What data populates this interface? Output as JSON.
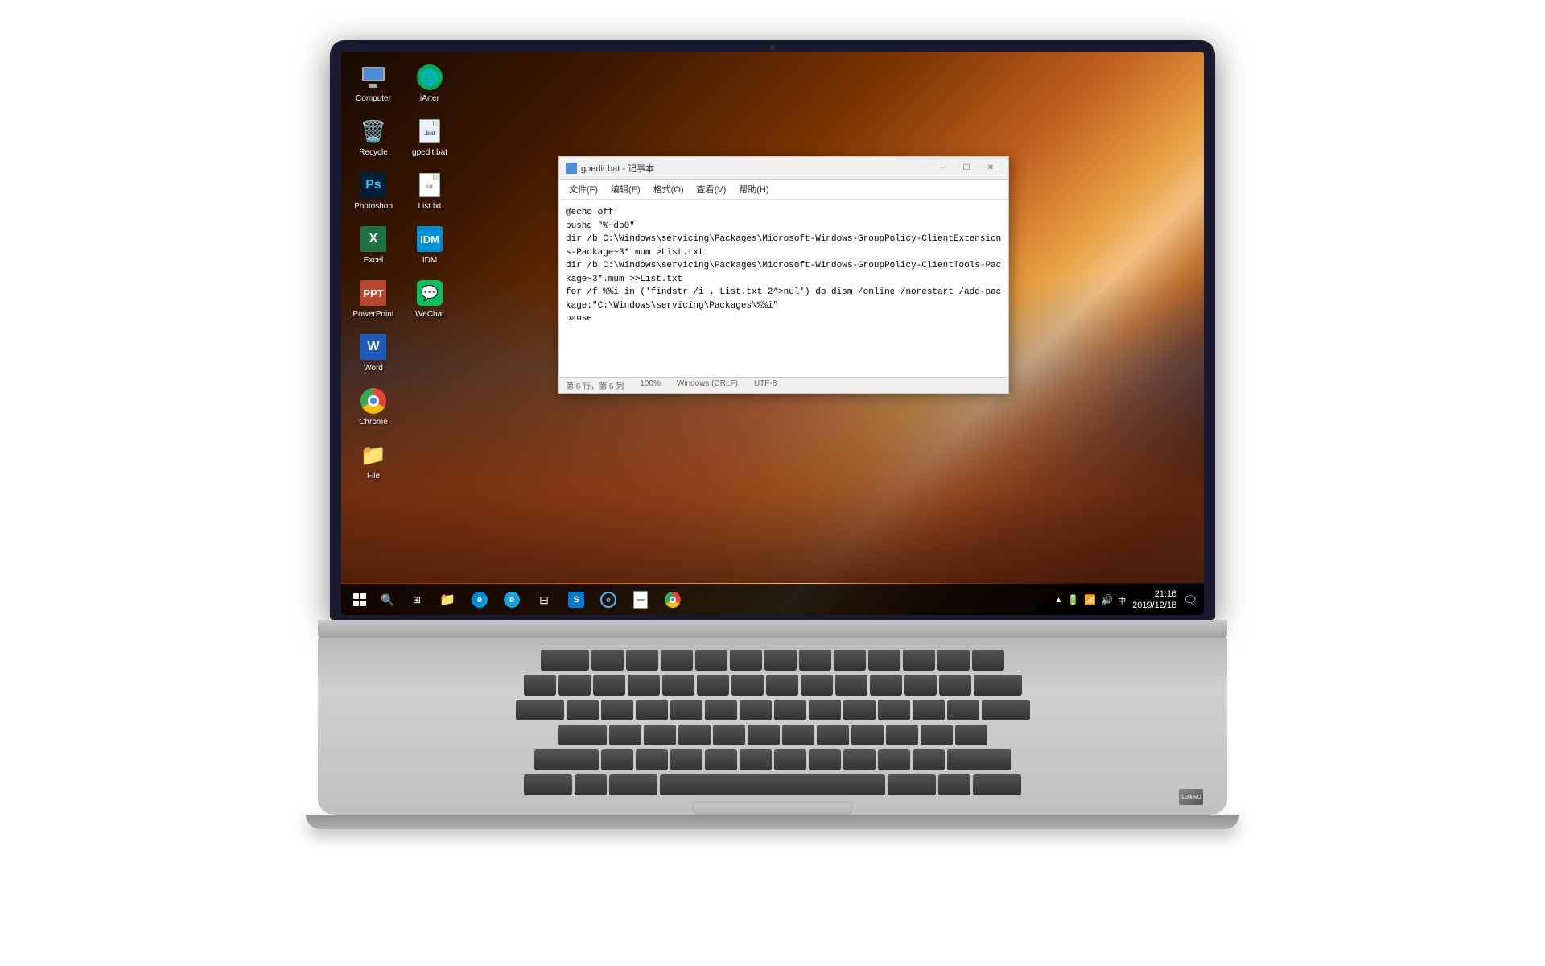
{
  "laptop": {
    "title": "Laptop with Windows 10 Desktop"
  },
  "desktop": {
    "icons": [
      {
        "id": "computer",
        "label": "Computer",
        "type": "computer",
        "row": 0,
        "col": 0
      },
      {
        "id": "iarter",
        "label": "iArter",
        "type": "globe",
        "row": 0,
        "col": 1
      },
      {
        "id": "recycle",
        "label": "Recycle",
        "type": "recycle",
        "row": 1,
        "col": 0
      },
      {
        "id": "gpedit",
        "label": "gpedit.bat",
        "type": "file",
        "row": 1,
        "col": 1
      },
      {
        "id": "photoshop",
        "label": "Photoshop",
        "type": "ps",
        "row": 2,
        "col": 0
      },
      {
        "id": "listtxt",
        "label": "List.txt",
        "type": "txt",
        "row": 2,
        "col": 1
      },
      {
        "id": "excel",
        "label": "Excel",
        "type": "excel",
        "row": 3,
        "col": 0
      },
      {
        "id": "idm",
        "label": "IDM",
        "type": "idm",
        "row": 3,
        "col": 1
      },
      {
        "id": "powerpoint",
        "label": "PowerPoint",
        "type": "ppt",
        "row": 4,
        "col": 0
      },
      {
        "id": "wechat",
        "label": "WeChat",
        "type": "wechat",
        "row": 4,
        "col": 1
      },
      {
        "id": "word",
        "label": "Word",
        "type": "word",
        "row": 5,
        "col": 0
      },
      {
        "id": "chrome",
        "label": "Chrome",
        "type": "chrome",
        "row": 6,
        "col": 0
      },
      {
        "id": "file",
        "label": "File",
        "type": "filefolder",
        "row": 7,
        "col": 0
      }
    ]
  },
  "notepad": {
    "title": "gpedit.bat - 记事本",
    "menu_items": [
      "文件(F)",
      "编辑(E)",
      "格式(O)",
      "查看(V)",
      "帮助(H)"
    ],
    "content": "@echo off\npushd \"%~dp0\"\ndir /b C:\\Windows\\servicing\\Packages\\Microsoft-Windows-GroupPolicy-ClientExtensions-Package~3*.mum >List.txt\ndir /b C:\\Windows\\servicing\\Packages\\Microsoft-Windows-GroupPolicy-ClientTools-Package~3*.mum >>List.txt\nfor /f %%i in ('findstr /i . List.txt 2^>nul') do dism /online /norestart /add-package:\"C:\\Windows\\servicing\\Packages\\%%i\"\npause",
    "statusbar": {
      "position": "第 6 行，第 6 列",
      "zoom": "100%",
      "line_ending": "Windows (CRLF)",
      "encoding": "UTF-8"
    }
  },
  "taskbar": {
    "clock": {
      "time": "21:16",
      "date": "2019/12/18"
    },
    "apps": [
      "start",
      "search",
      "task-view",
      "file-explorer",
      "edge-chromium",
      "ie",
      "taskbar-manager",
      "win-store",
      "edge-old",
      "notepad-pinned",
      "chrome-taskbar"
    ]
  }
}
